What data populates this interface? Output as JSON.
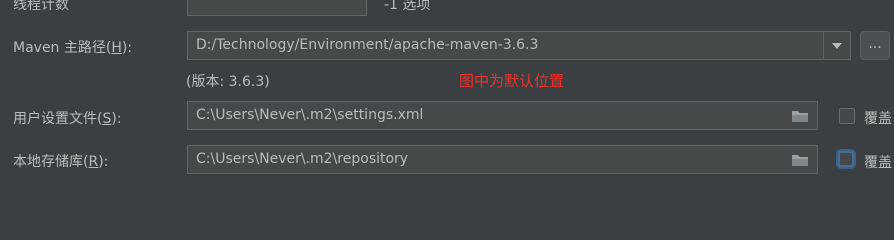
{
  "thread_count": {
    "label": "线程计数",
    "value": "",
    "hint": "-1 选项"
  },
  "maven_home": {
    "label_prefix": "Maven 主路径(",
    "mnemonic": "H",
    "label_suffix": "):",
    "value": "D:/Technology/Environment/apache-maven-3.6.3",
    "browse_label": "...",
    "version_text": "(版本: 3.6.3)"
  },
  "annotation": {
    "text": "图中为默认位置",
    "color": "#e8322d"
  },
  "user_settings": {
    "label_prefix": "用户设置文件(",
    "mnemonic": "S",
    "label_suffix": "):",
    "value": "C:\\Users\\Never\\.m2\\settings.xml",
    "override_label": "覆盖"
  },
  "local_repo": {
    "label_prefix": "本地存储库(",
    "mnemonic": "R",
    "label_suffix": "):",
    "value": "C:\\Users\\Never\\.m2\\repository",
    "override_label": "覆盖"
  },
  "icons": {
    "browse_folder": "folder-icon",
    "dropdown": "chevron-down-icon"
  }
}
